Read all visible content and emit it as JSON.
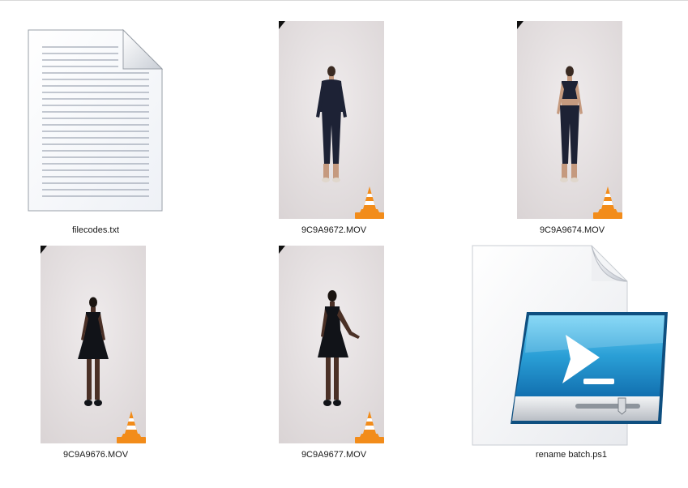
{
  "files": [
    {
      "name": "filecodes.txt",
      "type": "text-document",
      "icon": "text-document-icon"
    },
    {
      "name": "9C9A9672.MOV",
      "type": "video",
      "icon": "vlc-cone-icon"
    },
    {
      "name": "9C9A9674.MOV",
      "type": "video",
      "icon": "vlc-cone-icon"
    },
    {
      "name": "9C9A9676.MOV",
      "type": "video",
      "icon": "vlc-cone-icon"
    },
    {
      "name": "9C9A9677.MOV",
      "type": "video",
      "icon": "vlc-cone-icon"
    },
    {
      "name": "rename batch.ps1",
      "type": "powershell-script",
      "icon": "powershell-script-icon"
    }
  ],
  "colors": {
    "vlc_orange": "#f28c1a",
    "studio_bg": "#e6e1e2",
    "powershell_blue": "#2a9fd6"
  }
}
